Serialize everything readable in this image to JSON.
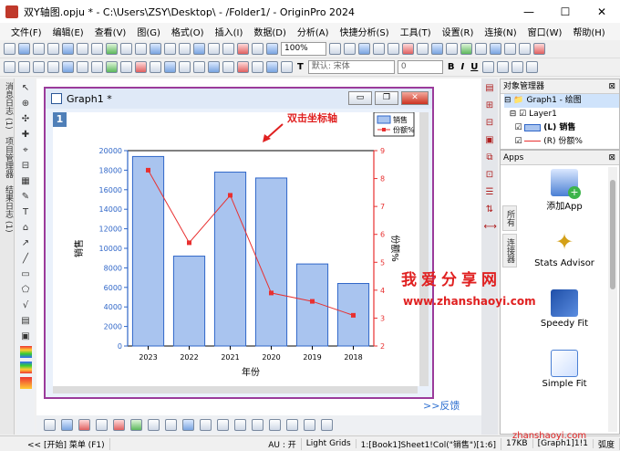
{
  "window": {
    "title": "双Y轴图.opju * - C:\\Users\\ZSY\\Desktop\\ - /Folder1/ - OriginPro 2024",
    "controls": [
      "—",
      "☐",
      "✕"
    ]
  },
  "menu": [
    "文件(F)",
    "编辑(E)",
    "查看(V)",
    "图(G)",
    "格式(O)",
    "插入(I)",
    "数据(D)",
    "分析(A)",
    "快捷分析(S)",
    "工具(T)",
    "设置(R)",
    "连接(N)",
    "窗口(W)",
    "帮助(H)"
  ],
  "toolbar": {
    "zoom": "100%",
    "font": "默认: 宋体",
    "size": "0",
    "bold": "B",
    "italic": "I",
    "underline": "U"
  },
  "left_tabs": [
    "消息日志 (1)",
    "项目管理器",
    "结果日志 (1)"
  ],
  "graph": {
    "window_title": "Graph1 *",
    "layer_number": "1",
    "annotation": "双击坐标轴",
    "chart_data": {
      "type": "bar",
      "categories": [
        "2023",
        "2022",
        "2021",
        "2020",
        "2019",
        "2018"
      ],
      "series": [
        {
          "name": "销售",
          "type": "bar",
          "axis": "left",
          "values": [
            19400,
            9200,
            17800,
            17200,
            8400,
            6400
          ]
        },
        {
          "name": "份额%",
          "type": "line",
          "axis": "right",
          "values": [
            8.3,
            5.7,
            7.4,
            3.9,
            3.6,
            3.1
          ]
        }
      ],
      "xlabel": "年份",
      "ylabel": "销售",
      "y2label": "份额%",
      "ylim": [
        0,
        20000
      ],
      "y2lim": [
        2,
        9
      ],
      "yticks": [
        "0",
        "2000",
        "4000",
        "6000",
        "8000",
        "10000",
        "12000",
        "14000",
        "16000",
        "18000",
        "20000"
      ],
      "y2ticks": [
        "2",
        "3",
        "4",
        "5",
        "6",
        "7",
        "8",
        "9"
      ],
      "legend": {
        "position": "top-right",
        "entries": [
          "销售",
          "份额%"
        ]
      },
      "colors": {
        "bar_fill": "#a9c4ef",
        "bar_stroke": "#2f66c8",
        "line": "#e83030",
        "left_axis": "#2f66c8",
        "right_axis": "#e83030"
      }
    }
  },
  "feedback": ">>反馈",
  "object_manager": {
    "title": "对象管理器",
    "items": [
      "Graph1 - 绘图",
      "Layer1",
      "(L) 销售",
      "(R) 份额%"
    ]
  },
  "apps": {
    "title": "Apps",
    "tabs": [
      "所有",
      "连接器"
    ],
    "items": [
      "添加App",
      "Stats Advisor",
      "Speedy Fit",
      "Simple Fit"
    ]
  },
  "status": {
    "left": "<< [开始] 菜单 (F1)",
    "au": "AU : 开",
    "grid": "Light Grids",
    "cell": "1:[Book1]Sheet1!Col(\"销售\")[1:6]",
    "size": "17KB",
    "window": "[Graph1]1!1",
    "angle": "弧度"
  },
  "watermark": {
    "cn": "我爱分享网",
    "url": "www.zhanshaoyi.com",
    "bottom": "zhanshaoyi.com"
  }
}
